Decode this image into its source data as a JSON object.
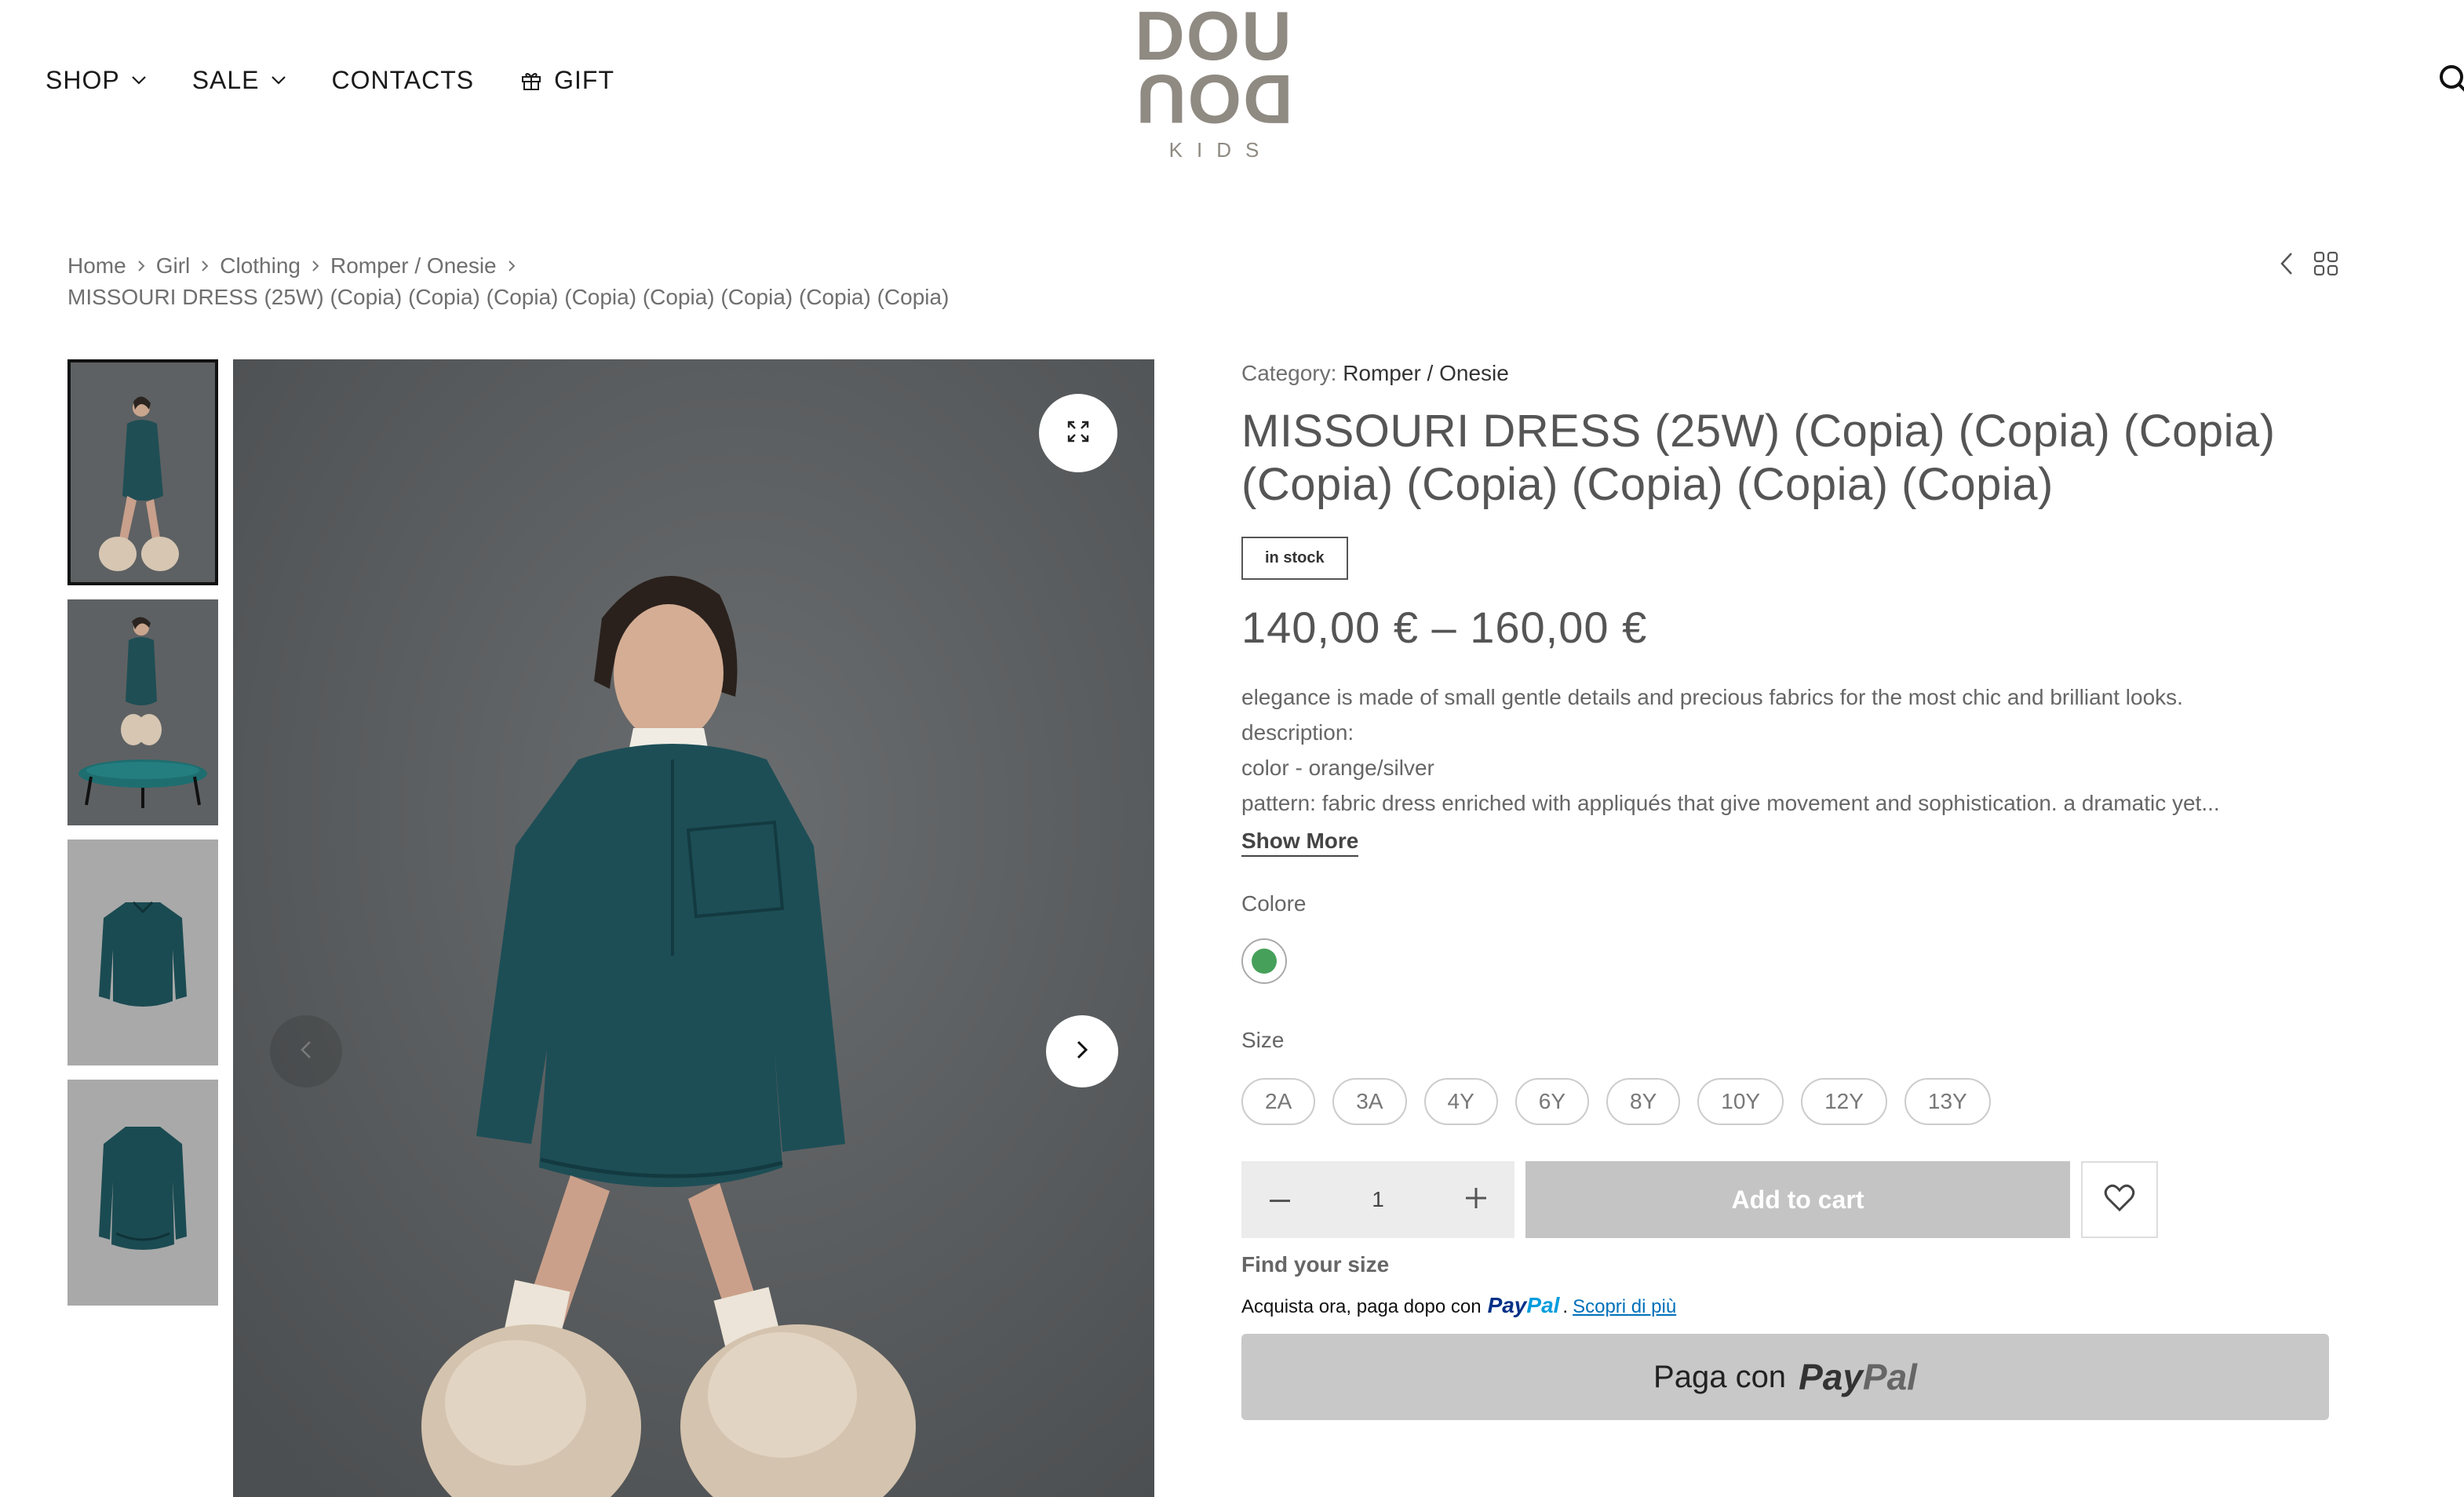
{
  "header": {
    "nav": [
      {
        "label": "SHOP"
      },
      {
        "label": "SALE"
      },
      {
        "label": "CONTACTS"
      },
      {
        "label": "GIFT"
      }
    ],
    "logo": {
      "top": "DOU",
      "mirror": "DOU",
      "sub": "KIDS"
    },
    "icons": {
      "search": "search-icon",
      "gift": "gift-icon",
      "dropdown": "chevron-down-icon"
    }
  },
  "breadcrumb": {
    "items": [
      "Home",
      "Girl",
      "Clothing",
      "Romper / Onesie"
    ],
    "current": "MISSOURI DRESS (25W) (Copia) (Copia) (Copia) (Copia) (Copia) (Copia) (Copia) (Copia)"
  },
  "gallery": {
    "thumbnail_count": 4,
    "active_index": 0
  },
  "product": {
    "category_label": "Category:",
    "category": "Romper / Onesie",
    "title": "MISSOURI DRESS (25W) (Copia) (Copia) (Copia) (Copia) (Copia) (Copia) (Copia) (Copia)",
    "stock": "in stock",
    "price": "140,00 € – 160,00 €",
    "description": [
      "elegance is made of small gentle details and precious fabrics for the most chic and brilliant looks.",
      "description:",
      "color - orange/silver",
      "pattern: fabric dress enriched with appliqués that give movement and sophistication. a dramatic yet..."
    ],
    "show_more": "Show More",
    "color_label": "Colore",
    "color_swatch": "#46a05a",
    "size_label": "Size",
    "sizes": [
      "2A",
      "3A",
      "4Y",
      "6Y",
      "8Y",
      "10Y",
      "12Y",
      "13Y"
    ],
    "quantity": "1",
    "add_to_cart": "Add to cart",
    "find_size": "Find your size",
    "paypal_msg": "Acquista ora, paga dopo con",
    "paypal_word_1": "Pay",
    "paypal_word_2": "Pal",
    "paypal_period": ".",
    "paypal_link": "Scopri di più",
    "paypal_button": "Paga con"
  }
}
